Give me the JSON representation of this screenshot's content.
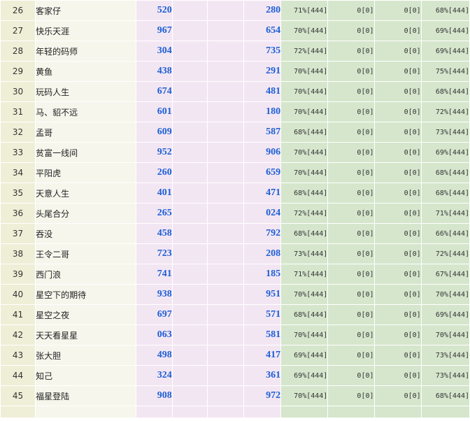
{
  "rows": [
    {
      "rank": "26",
      "name": "客家仔",
      "num1": "520",
      "num2": "280",
      "pct1": "71%[444]",
      "z1": "0[0]",
      "z2": "0[0]",
      "pct2": "68%[444]"
    },
    {
      "rank": "27",
      "name": "快乐天涯",
      "num1": "967",
      "num2": "654",
      "pct1": "70%[444]",
      "z1": "0[0]",
      "z2": "0[0]",
      "pct2": "69%[444]"
    },
    {
      "rank": "28",
      "name": "年轻的码师",
      "num1": "304",
      "num2": "735",
      "pct1": "72%[444]",
      "z1": "0[0]",
      "z2": "0[0]",
      "pct2": "69%[444]"
    },
    {
      "rank": "29",
      "name": "黄鱼",
      "num1": "438",
      "num2": "291",
      "pct1": "70%[444]",
      "z1": "0[0]",
      "z2": "0[0]",
      "pct2": "75%[444]"
    },
    {
      "rank": "30",
      "name": "玩码人生",
      "num1": "674",
      "num2": "481",
      "pct1": "70%[444]",
      "z1": "0[0]",
      "z2": "0[0]",
      "pct2": "68%[444]"
    },
    {
      "rank": "31",
      "name": "马、貂不远",
      "num1": "601",
      "num2": "180",
      "pct1": "70%[444]",
      "z1": "0[0]",
      "z2": "0[0]",
      "pct2": "72%[444]"
    },
    {
      "rank": "32",
      "name": "孟哥",
      "num1": "609",
      "num2": "587",
      "pct1": "68%[444]",
      "z1": "0[0]",
      "z2": "0[0]",
      "pct2": "73%[444]"
    },
    {
      "rank": "33",
      "name": "贫富一线间",
      "num1": "952",
      "num2": "906",
      "pct1": "70%[444]",
      "z1": "0[0]",
      "z2": "0[0]",
      "pct2": "69%[444]"
    },
    {
      "rank": "34",
      "name": "平阳虎",
      "num1": "260",
      "num2": "659",
      "pct1": "70%[444]",
      "z1": "0[0]",
      "z2": "0[0]",
      "pct2": "68%[444]"
    },
    {
      "rank": "35",
      "name": "天意人生",
      "num1": "401",
      "num2": "471",
      "pct1": "68%[444]",
      "z1": "0[0]",
      "z2": "0[0]",
      "pct2": "68%[444]"
    },
    {
      "rank": "36",
      "name": "头尾合分",
      "num1": "265",
      "num2": "024",
      "pct1": "72%[444]",
      "z1": "0[0]",
      "z2": "0[0]",
      "pct2": "71%[444]"
    },
    {
      "rank": "37",
      "name": "吞没",
      "num1": "458",
      "num2": "792",
      "pct1": "68%[444]",
      "z1": "0[0]",
      "z2": "0[0]",
      "pct2": "66%[444]"
    },
    {
      "rank": "38",
      "name": "王令二哥",
      "num1": "723",
      "num2": "208",
      "pct1": "73%[444]",
      "z1": "0[0]",
      "z2": "0[0]",
      "pct2": "72%[444]"
    },
    {
      "rank": "39",
      "name": "西门浪",
      "num1": "741",
      "num2": "185",
      "pct1": "71%[444]",
      "z1": "0[0]",
      "z2": "0[0]",
      "pct2": "67%[444]"
    },
    {
      "rank": "40",
      "name": "星空下的期待",
      "num1": "938",
      "num2": "951",
      "pct1": "70%[444]",
      "z1": "0[0]",
      "z2": "0[0]",
      "pct2": "70%[444]"
    },
    {
      "rank": "41",
      "name": "星空之夜",
      "num1": "697",
      "num2": "571",
      "pct1": "68%[444]",
      "z1": "0[0]",
      "z2": "0[0]",
      "pct2": "69%[444]"
    },
    {
      "rank": "42",
      "name": "天天看星星",
      "num1": "063",
      "num2": "581",
      "pct1": "70%[444]",
      "z1": "0[0]",
      "z2": "0[0]",
      "pct2": "70%[444]"
    },
    {
      "rank": "43",
      "name": "张大胆",
      "num1": "498",
      "num2": "417",
      "pct1": "69%[444]",
      "z1": "0[0]",
      "z2": "0[0]",
      "pct2": "73%[444]"
    },
    {
      "rank": "44",
      "name": "知己",
      "num1": "324",
      "num2": "361",
      "pct1": "69%[444]",
      "z1": "0[0]",
      "z2": "0[0]",
      "pct2": "73%[444]"
    },
    {
      "rank": "45",
      "name": "福星登陆",
      "num1": "908",
      "num2": "972",
      "pct1": "70%[444]",
      "z1": "0[0]",
      "z2": "0[0]",
      "pct2": "68%[444]"
    }
  ]
}
